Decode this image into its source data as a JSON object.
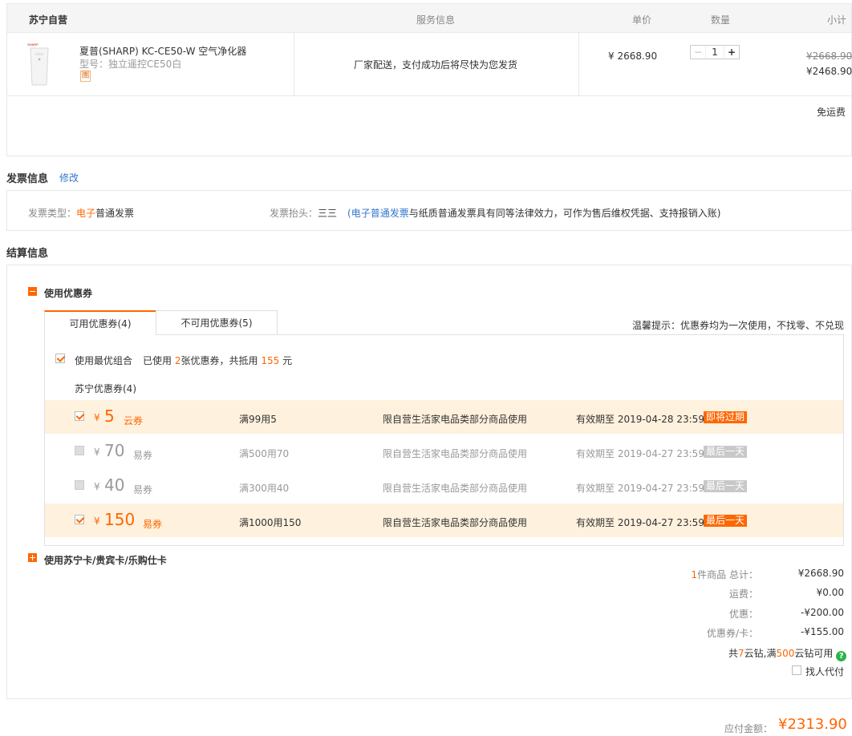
{
  "order": {
    "shop": "苏宁自营",
    "headers": {
      "service": "服务信息",
      "price": "单价",
      "qty": "数量",
      "subtotal": "小计"
    },
    "product": {
      "name": "夏普(SHARP) KC-CE50-W 空气净化器",
      "model": "型号：独立遥控CE50白",
      "badge": "團",
      "service": "厂家配送，支付成功后将尽快为您发货",
      "unit_price": "¥ 2668.90",
      "quantity": "1",
      "minus": "−",
      "plus": "+",
      "original_subtotal": "¥2668.90",
      "subtotal": "¥2468.90"
    },
    "shipping_note": "免运费"
  },
  "invoice": {
    "title": "发票信息",
    "edit": "修改",
    "type_label": "发票类型：",
    "type_hl": "电子",
    "type_rest": "普通发票",
    "header_label": "发票抬头：",
    "header_value": "三三",
    "note_open": "(",
    "note_link": "电子普通发票",
    "note_rest": "与纸质普通发票具有同等法律效力，可作为售后维权凭据、支持报销入账)"
  },
  "settlement": {
    "title": "结算信息",
    "use_coupon": "使用优惠券",
    "tab_available": "可用优惠券(4)",
    "tab_unavailable": "不可用优惠券(5)",
    "tip": "温馨提示：优惠券均为一次使用，不找零、不兑现",
    "best_combo": "使用最优组合",
    "used_pre": "已使用",
    "used_count": "2",
    "used_mid": "张优惠券，共抵用",
    "used_amount": "155",
    "used_unit": "元",
    "group_label": "苏宁优惠券(4)",
    "coupons": [
      {
        "yen": "¥",
        "amount": "5",
        "kind": "云券",
        "rule": "满99用5",
        "scope": "限自营生活家电品类部分商品使用",
        "valid": "有效期至 2019-04-28 23:59",
        "tag": "即将过期"
      },
      {
        "yen": "¥",
        "amount": "70",
        "kind": "易券",
        "rule": "满500用70",
        "scope": "限自营生活家电品类部分商品使用",
        "valid": "有效期至 2019-04-27 23:59",
        "tag": "最后一天"
      },
      {
        "yen": "¥",
        "amount": "40",
        "kind": "易券",
        "rule": "满300用40",
        "scope": "限自营生活家电品类部分商品使用",
        "valid": "有效期至 2019-04-27 23:59",
        "tag": "最后一天"
      },
      {
        "yen": "¥",
        "amount": "150",
        "kind": "易券",
        "rule": "满1000用150",
        "scope": "限自营生活家电品类部分商品使用",
        "valid": "有效期至 2019-04-27 23:59",
        "tag": "最后一天"
      }
    ],
    "use_card": "使用苏宁卡/贵宾卡/乐购仕卡"
  },
  "summary": {
    "count": "1",
    "total_label": "件商品 总计：",
    "total": "¥2668.90",
    "shipping_label": "运费：",
    "shipping": "¥0.00",
    "discount_label": "优惠：",
    "discount": "-¥200.00",
    "coupon_label": "优惠券/卡：",
    "coupon": "-¥155.00",
    "yunzuan_pre": "共",
    "yunzuan_count": "7",
    "yunzuan_mid": "云钻,满",
    "yunzuan_min": "500",
    "yunzuan_post": "云钻可用",
    "help_icon": "?",
    "proxy_pay": "找人代付",
    "payable_label": "应付金额：",
    "payable": "¥2313.90"
  }
}
